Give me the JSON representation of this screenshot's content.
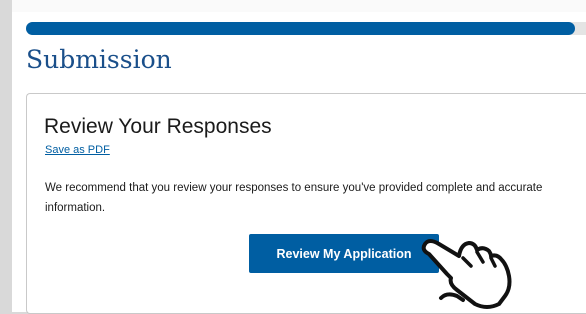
{
  "progress": {
    "fraction": 0.98,
    "fill_color": "#005ea2"
  },
  "header": {
    "title": "Submission"
  },
  "review_card": {
    "title": "Review Your Responses",
    "save_pdf_link": "Save as PDF",
    "description": "We recommend that you review your responses to ensure you've provided complete and accurate information.",
    "button_label": "Review My Application"
  },
  "cursor": {
    "icon": "hand-pointer-icon"
  },
  "colors": {
    "accent": "#005ea2",
    "heading": "#1a4f8a",
    "page_background": "#d9d9d9"
  }
}
